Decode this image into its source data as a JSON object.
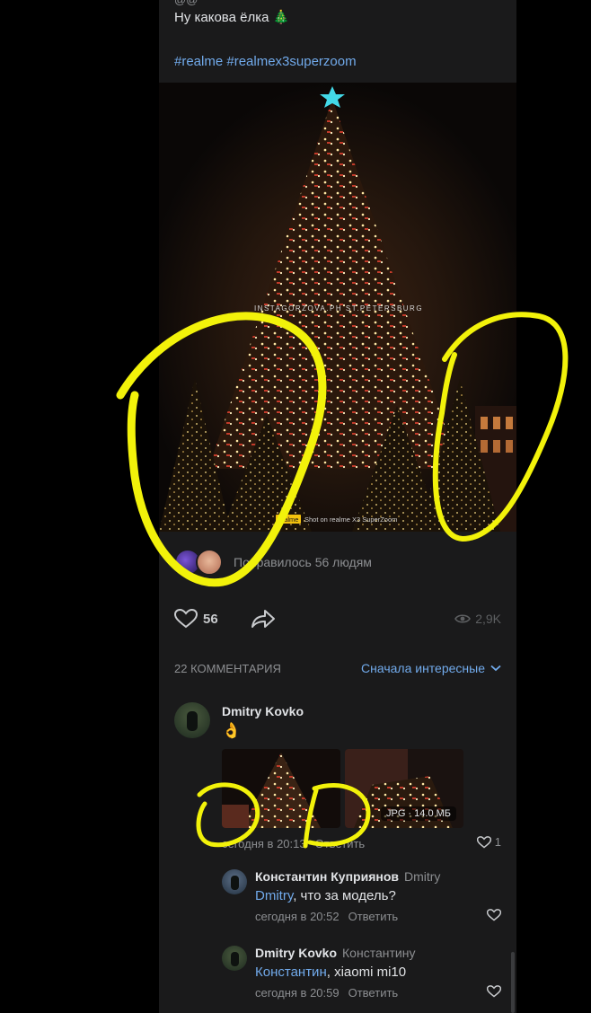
{
  "post": {
    "cut_line": "@@",
    "text": "Ну какова ёлка",
    "text_emoji": "🎄",
    "hashtags": "#realme #realmex3superzoom",
    "photo": {
      "watermark": "INSTAGORZOVA.PH ST.PETERSBURG",
      "brand_badge": "realme",
      "shot_on": "Shot on realme X3 SuperZoom"
    },
    "liked_by_text": "Понравилось 56 людям",
    "likes_count": "56",
    "views_count": "2,9K"
  },
  "comments_header": {
    "count_label": "22 КОММЕНТАРИЯ",
    "sort_label": "Сначала интересные"
  },
  "comment": {
    "author": "Dmitry Kovko",
    "emoji": "👌",
    "attachment_badge": "JPG · 14.0 МБ",
    "time": "сегодня в 20:13",
    "reply_label": "Ответить",
    "likes": "1"
  },
  "replies": [
    {
      "author": "Константин Куприянов",
      "to": "Dmitry",
      "mention": "Dmitry",
      "text": ", что за модель?",
      "time": "сегодня в 20:52",
      "reply_label": "Ответить"
    },
    {
      "author": "Dmitry Kovko",
      "to": "Константину",
      "mention": "Константин",
      "text": ", xiaomi mi10",
      "time": "сегодня в 20:59",
      "reply_label": "Ответить"
    }
  ],
  "colors": {
    "background": "#000000",
    "card": "#1a1a1b",
    "link": "#71aaeb",
    "secondary_text": "#8c8e91",
    "highlight_marker": "#f2f20a"
  },
  "icons": {
    "like": "heart-icon",
    "share": "share-arrow-icon",
    "views": "eye-icon",
    "sort": "chevron-down-icon"
  }
}
